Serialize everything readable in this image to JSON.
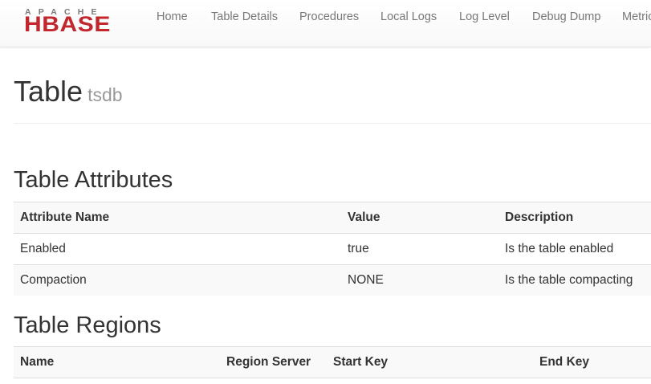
{
  "navbar": {
    "logo_top": "APACHE",
    "logo_main": "HBASE",
    "items": [
      "Home",
      "Table Details",
      "Procedures",
      "Local Logs",
      "Log Level",
      "Debug Dump",
      "Metrics"
    ]
  },
  "page": {
    "title": "Table",
    "subtitle": "tsdb"
  },
  "attributes": {
    "heading": "Table Attributes",
    "columns": [
      "Attribute Name",
      "Value",
      "Description"
    ],
    "rows": [
      [
        "Enabled",
        "true",
        "Is the table enabled"
      ],
      [
        "Compaction",
        "NONE",
        "Is the table compacting"
      ]
    ]
  },
  "regions": {
    "heading": "Table Regions",
    "columns": [
      "Name",
      "Region Server",
      "Start Key",
      "End Key"
    ]
  },
  "colors": {
    "brand": "#c1272d",
    "nav_text": "#777777",
    "subtitle": "#999999",
    "row_shade": "#f9f9f9"
  }
}
